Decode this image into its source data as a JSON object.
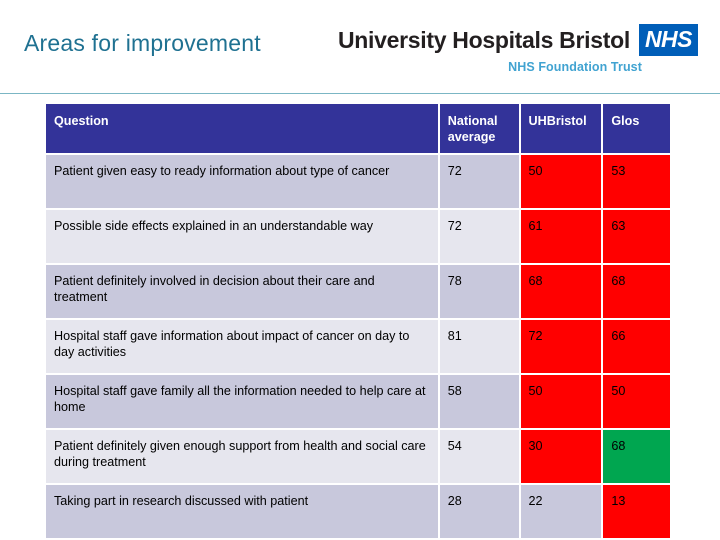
{
  "header": {
    "title": "Areas for improvement",
    "org_name": "University Hospitals Bristol",
    "nhs_logo_text": "NHS",
    "trust_line": "NHS Foundation Trust",
    "title_color": "#1f7191",
    "nhs_blue": "#005eb8",
    "rule_color": "#7bb6c4"
  },
  "table": {
    "header_bg": "#333399",
    "row_dark_bg": "#c8c8dc",
    "row_light_bg": "#e6e6ee",
    "highlight_red": "#ff0000",
    "highlight_green": "#00a650",
    "columns": [
      {
        "key": "question",
        "label": "Question"
      },
      {
        "key": "national",
        "label": "National average"
      },
      {
        "key": "uhbristol",
        "label": "UHBristol"
      },
      {
        "key": "glos",
        "label": "Glos"
      }
    ],
    "rows": [
      {
        "question": "Patient given easy to ready information about type of cancer",
        "national": "72",
        "uhbristol": "50",
        "glos": "53",
        "national_hl": "none",
        "uhbristol_hl": "red",
        "glos_hl": "red",
        "band": "dark"
      },
      {
        "question": "Possible side effects explained in an understandable way",
        "national": "72",
        "uhbristol": "61",
        "glos": "63",
        "national_hl": "none",
        "uhbristol_hl": "red",
        "glos_hl": "red",
        "band": "light"
      },
      {
        "question": "Patient definitely involved in decision about their care and treatment",
        "national": "78",
        "uhbristol": "68",
        "glos": "68",
        "national_hl": "none",
        "uhbristol_hl": "red",
        "glos_hl": "red",
        "band": "dark"
      },
      {
        "question": "Hospital staff gave information about impact of cancer on day to day activities",
        "national": "81",
        "uhbristol": "72",
        "glos": "66",
        "national_hl": "none",
        "uhbristol_hl": "red",
        "glos_hl": "red",
        "band": "light"
      },
      {
        "question": "Hospital staff gave family all the information needed to help care at home",
        "national": "58",
        "uhbristol": "50",
        "glos": "50",
        "national_hl": "none",
        "uhbristol_hl": "red",
        "glos_hl": "red",
        "band": "dark"
      },
      {
        "question": "Patient definitely given enough support from health and social care during treatment",
        "national": "54",
        "uhbristol": "30",
        "glos": "68",
        "national_hl": "none",
        "uhbristol_hl": "red",
        "glos_hl": "green",
        "band": "light"
      },
      {
        "question": "Taking part in research discussed with patient",
        "national": "28",
        "uhbristol": "22",
        "glos": "13",
        "national_hl": "none",
        "uhbristol_hl": "none",
        "glos_hl": "red",
        "band": "dark"
      }
    ]
  }
}
